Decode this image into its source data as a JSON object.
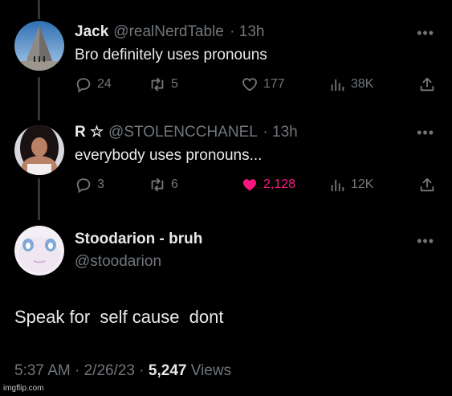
{
  "tweets": [
    {
      "name": "Jack",
      "handle": "@realNerdTable",
      "time": "· 13h",
      "text": "Bro definitely uses pronouns",
      "replies": "24",
      "retweets": "5",
      "likes": "177",
      "views": "38K",
      "liked": false
    },
    {
      "name": "R ☆",
      "handle": "@STOLENCCHANEL",
      "time": "· 13h",
      "text": "everybody uses pronouns...",
      "replies": "3",
      "retweets": "6",
      "likes": "2,128",
      "views": "12K",
      "liked": true
    }
  ],
  "main_tweet": {
    "name": "Stoodarion - bruh",
    "handle": "@stoodarion",
    "text": "Speak for  self cause  dont",
    "time": "5:37 AM",
    "date": "2/26/23",
    "views_count": "5,247",
    "views_label": "Views"
  },
  "more_glyph": "•••",
  "watermark": "imgflip.com",
  "colors": {
    "background": "#000000",
    "text": "#e7e9ea",
    "muted": "#71767b",
    "like_pink": "#f91880"
  }
}
